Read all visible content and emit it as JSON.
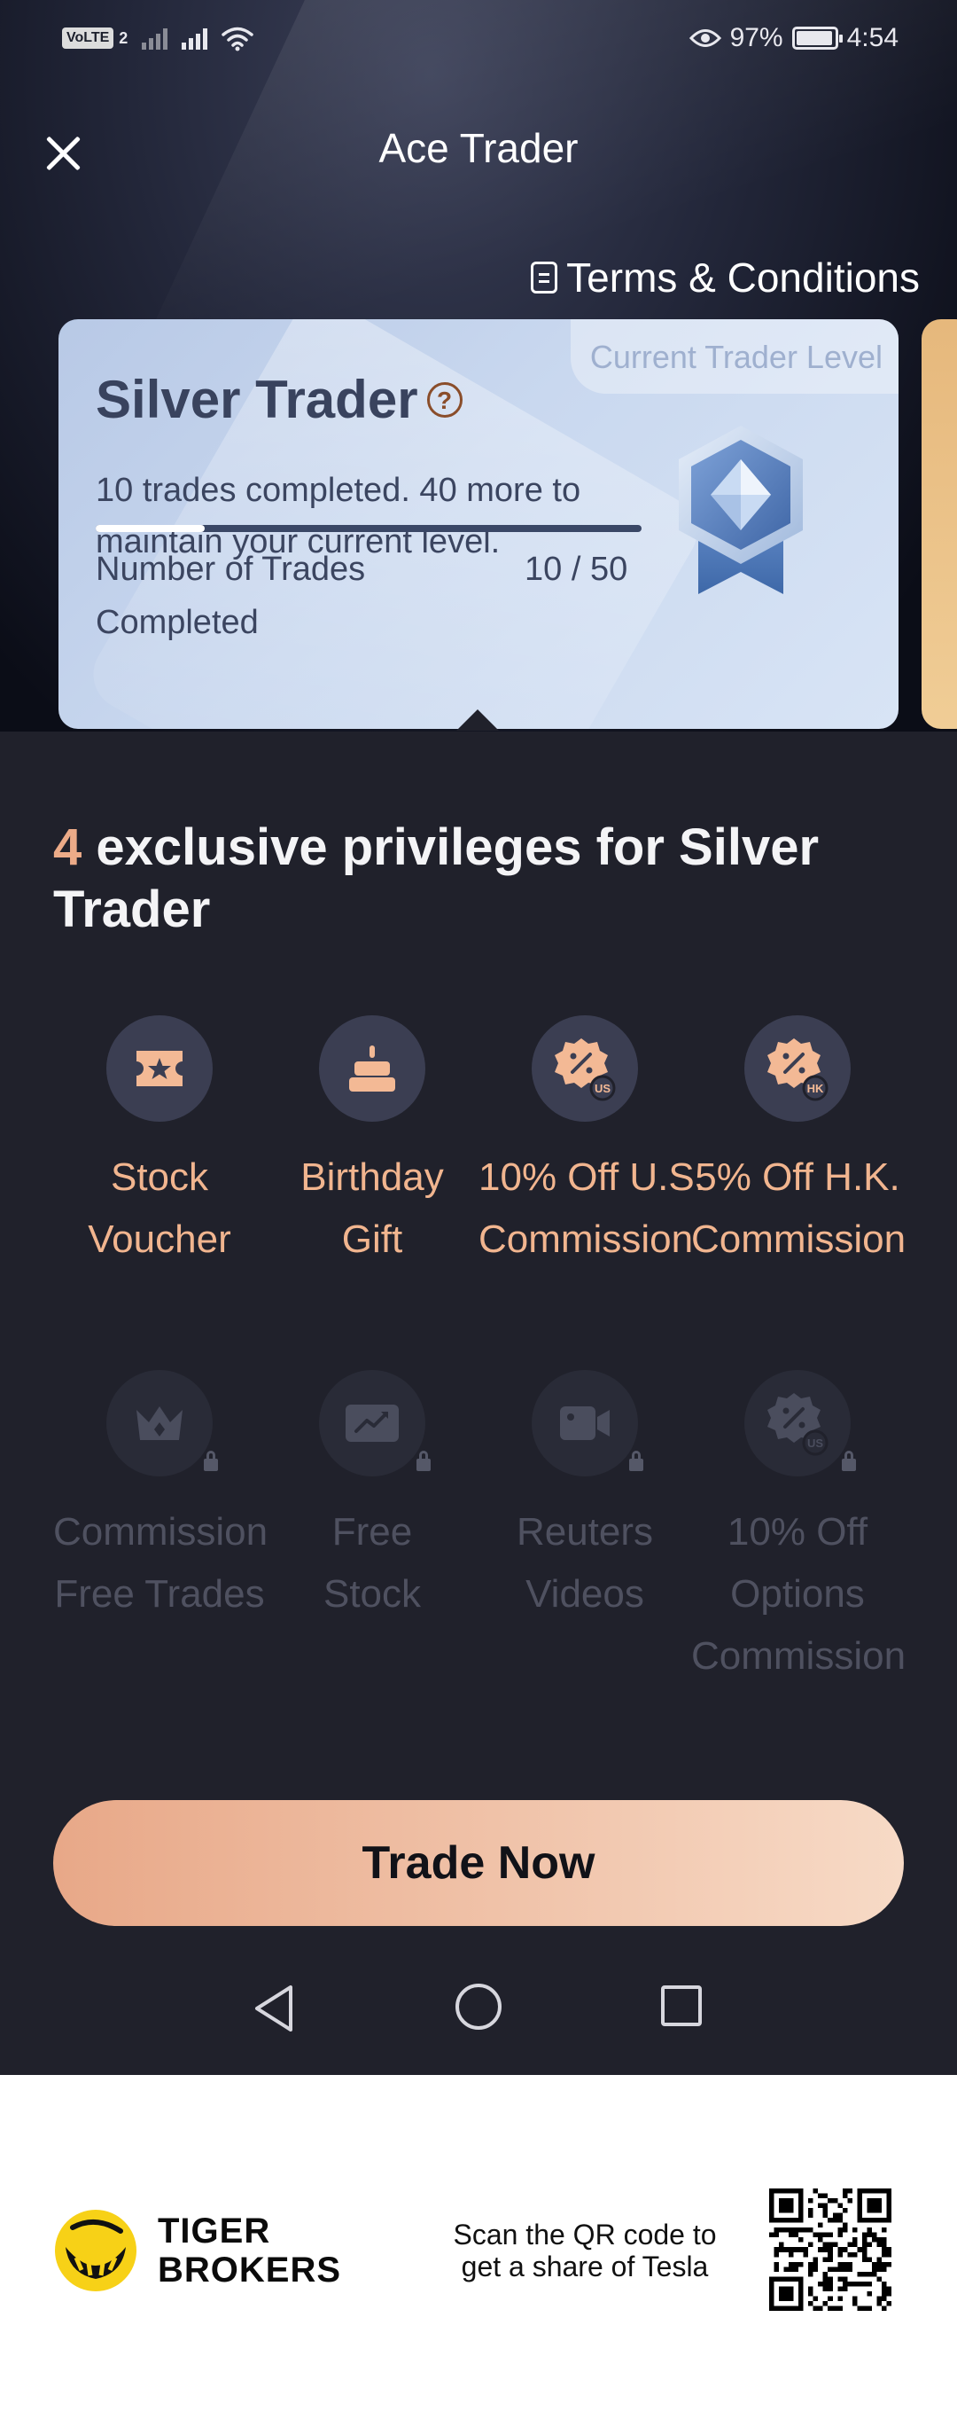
{
  "status_bar": {
    "network": "VoLTE",
    "sim": "2",
    "battery": "97%",
    "battery_level": 0.97,
    "time": "4:54"
  },
  "header": {
    "title": "Ace Trader",
    "terms_label": "Terms & Conditions"
  },
  "level_card": {
    "tag": "Current Trader Level",
    "level_name": "Silver Trader",
    "help_glyph": "?",
    "description": "10 trades completed. 40 more to maintain your current level.",
    "progress": 0.2,
    "trades_label": "Number of Trades Completed",
    "trades_value": "10 / 50",
    "badge_icon": "silver-diamond-medal",
    "accent_color": "#b8c9e6"
  },
  "privileges": {
    "count": "4",
    "heading_text": " exclusive privileges for Silver Trader",
    "unlocked": [
      {
        "label_line1": "Stock",
        "label_line2": "Voucher",
        "icon": "ticket-star-icon"
      },
      {
        "label_line1": "Birthday",
        "label_line2": "Gift",
        "icon": "cake-icon"
      },
      {
        "label_line1": "10% Off U.S.",
        "label_line2": "Commission",
        "icon": "discount-us-icon"
      },
      {
        "label_line1": "5% Off H.K.",
        "label_line2": "Commission",
        "icon": "discount-hk-icon"
      }
    ],
    "locked": [
      {
        "label_line1": "Commission",
        "label_line2": "Free Trades",
        "label_line3": "",
        "icon": "crown-icon"
      },
      {
        "label_line1": "Free",
        "label_line2": "Stock",
        "label_line3": "",
        "icon": "trend-chart-icon"
      },
      {
        "label_line1": "Reuters",
        "label_line2": "Videos",
        "label_line3": "",
        "icon": "video-camera-icon"
      },
      {
        "label_line1": "10% Off",
        "label_line2": "Options",
        "label_line3": "Commission",
        "icon": "discount-us-icon"
      }
    ]
  },
  "actions": {
    "trade_now": "Trade Now"
  },
  "footer": {
    "brand_line1": "TIGER",
    "brand_line2": "BROKERS",
    "scan_line1": "Scan the QR code to",
    "scan_line2": "get a share of Tesla"
  },
  "colors": {
    "accent": "#ecab88",
    "panel_bg": "#20212b",
    "button_gradient_start": "#e8a888",
    "button_gradient_end": "#f7dac6",
    "locked_text": "#4f5160"
  }
}
